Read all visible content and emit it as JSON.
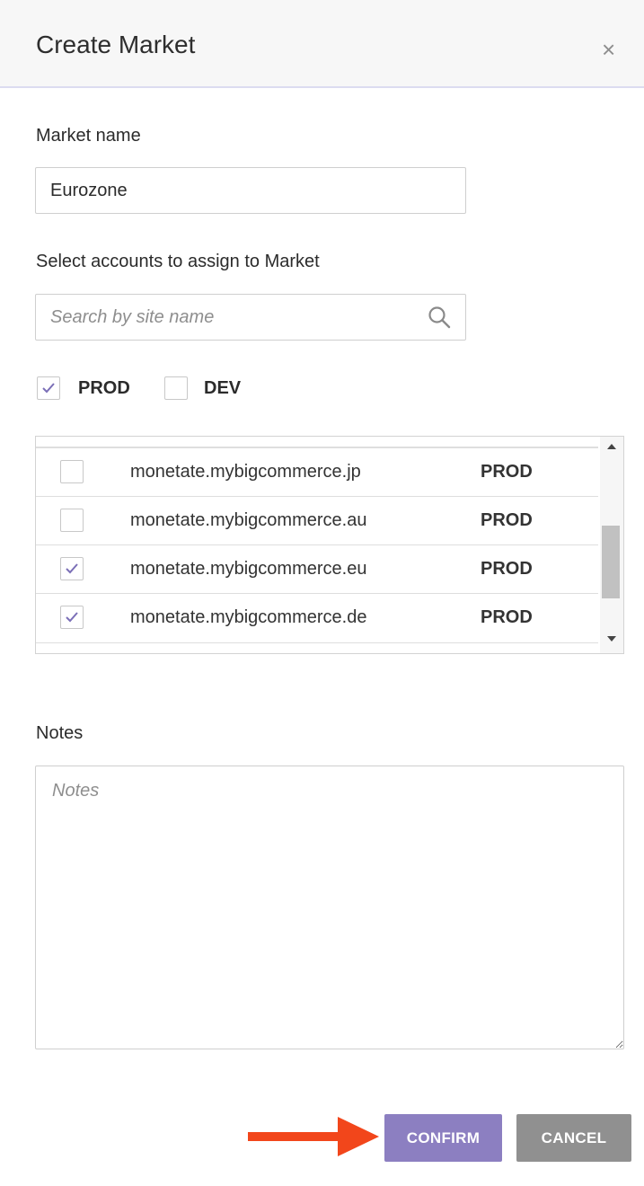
{
  "dialog": {
    "title": "Create Market",
    "close_glyph": "×"
  },
  "market_name": {
    "label": "Market name",
    "value": "Eurozone"
  },
  "accounts": {
    "label": "Select accounts to assign to Market",
    "search_placeholder": "Search by site name",
    "filters": [
      {
        "label": "PROD",
        "checked": true
      },
      {
        "label": "DEV",
        "checked": false
      }
    ],
    "rows": [
      {
        "site": "monetate.mybigcommerce.jp",
        "env": "PROD",
        "checked": false
      },
      {
        "site": "monetate.mybigcommerce.au",
        "env": "PROD",
        "checked": false
      },
      {
        "site": "monetate.mybigcommerce.eu",
        "env": "PROD",
        "checked": true
      },
      {
        "site": "monetate.mybigcommerce.de",
        "env": "PROD",
        "checked": true
      }
    ]
  },
  "notes": {
    "label": "Notes",
    "placeholder": "Notes",
    "value": ""
  },
  "buttons": {
    "confirm": "CONFIRM",
    "cancel": "CANCEL"
  },
  "colors": {
    "accent": "#8c7fc1",
    "cancel": "#909090",
    "arrow": "#f2461b"
  }
}
